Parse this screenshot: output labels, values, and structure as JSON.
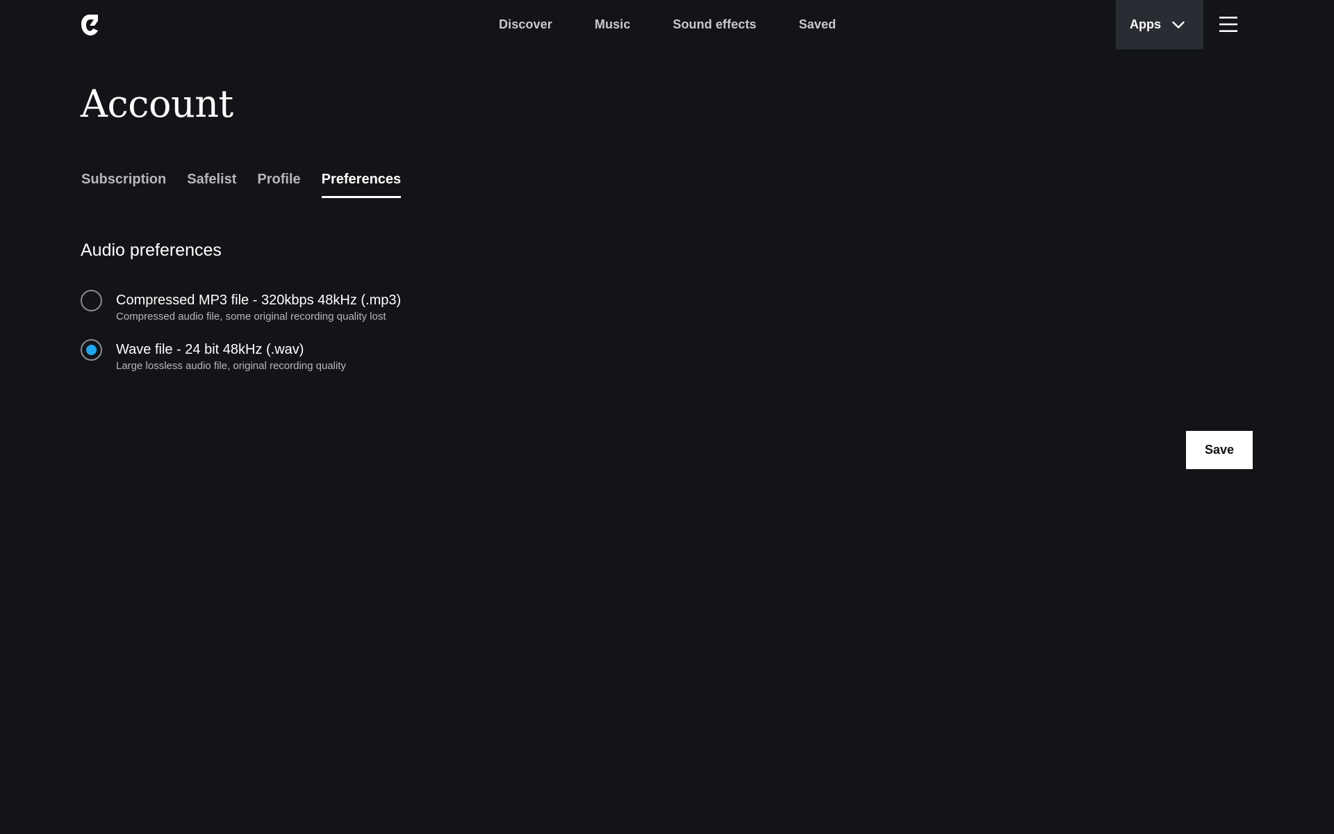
{
  "header": {
    "logo_icon": "brand-logo-icon",
    "nav": [
      {
        "label": "Discover"
      },
      {
        "label": "Music"
      },
      {
        "label": "Sound effects"
      },
      {
        "label": "Saved"
      }
    ],
    "apps_label": "Apps",
    "apps_icon": "chevron-down-icon",
    "menu_icon": "hamburger-menu-icon"
  },
  "page": {
    "title": "Account"
  },
  "tabs": [
    {
      "label": "Subscription",
      "active": false
    },
    {
      "label": "Safelist",
      "active": false
    },
    {
      "label": "Profile",
      "active": false
    },
    {
      "label": "Preferences",
      "active": true
    }
  ],
  "audio_preferences": {
    "title": "Audio preferences",
    "options": [
      {
        "title": "Compressed MP3 file - 320kbps 48kHz (.mp3)",
        "description": "Compressed audio file, some original recording quality lost",
        "selected": false
      },
      {
        "title": "Wave file - 24 bit 48kHz (.wav)",
        "description": "Large lossless audio file, original recording quality",
        "selected": true
      }
    ]
  },
  "actions": {
    "save_label": "Save"
  },
  "colors": {
    "background": "#131418",
    "apps_button_bg": "#2a2c33",
    "accent_radio": "#1ea8f0",
    "save_button_bg": "#ffffff"
  }
}
